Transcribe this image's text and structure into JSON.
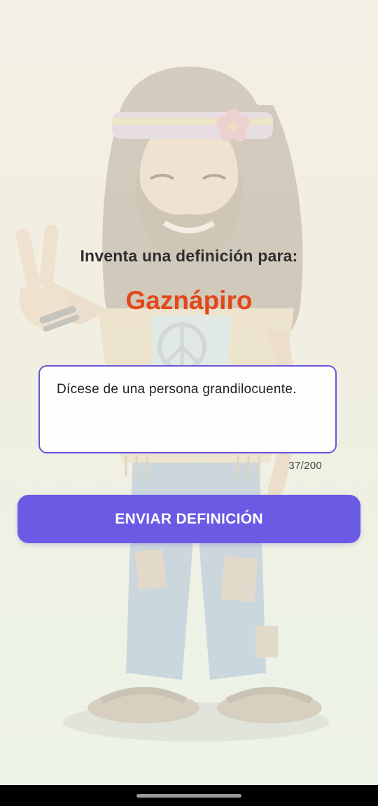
{
  "prompt_label": "Inventa una definición para:",
  "word": "Gaznápiro",
  "definition": {
    "value": "Dícese de una persona grandilocuente.",
    "counter": "37/200"
  },
  "submit_label": "ENVIAR DEFINICIÓN",
  "colors": {
    "accent": "#6a5ae4",
    "word": "#e2481a",
    "text": "#2e2e2e"
  },
  "icons": {
    "background": "hippie-character-illustration"
  }
}
